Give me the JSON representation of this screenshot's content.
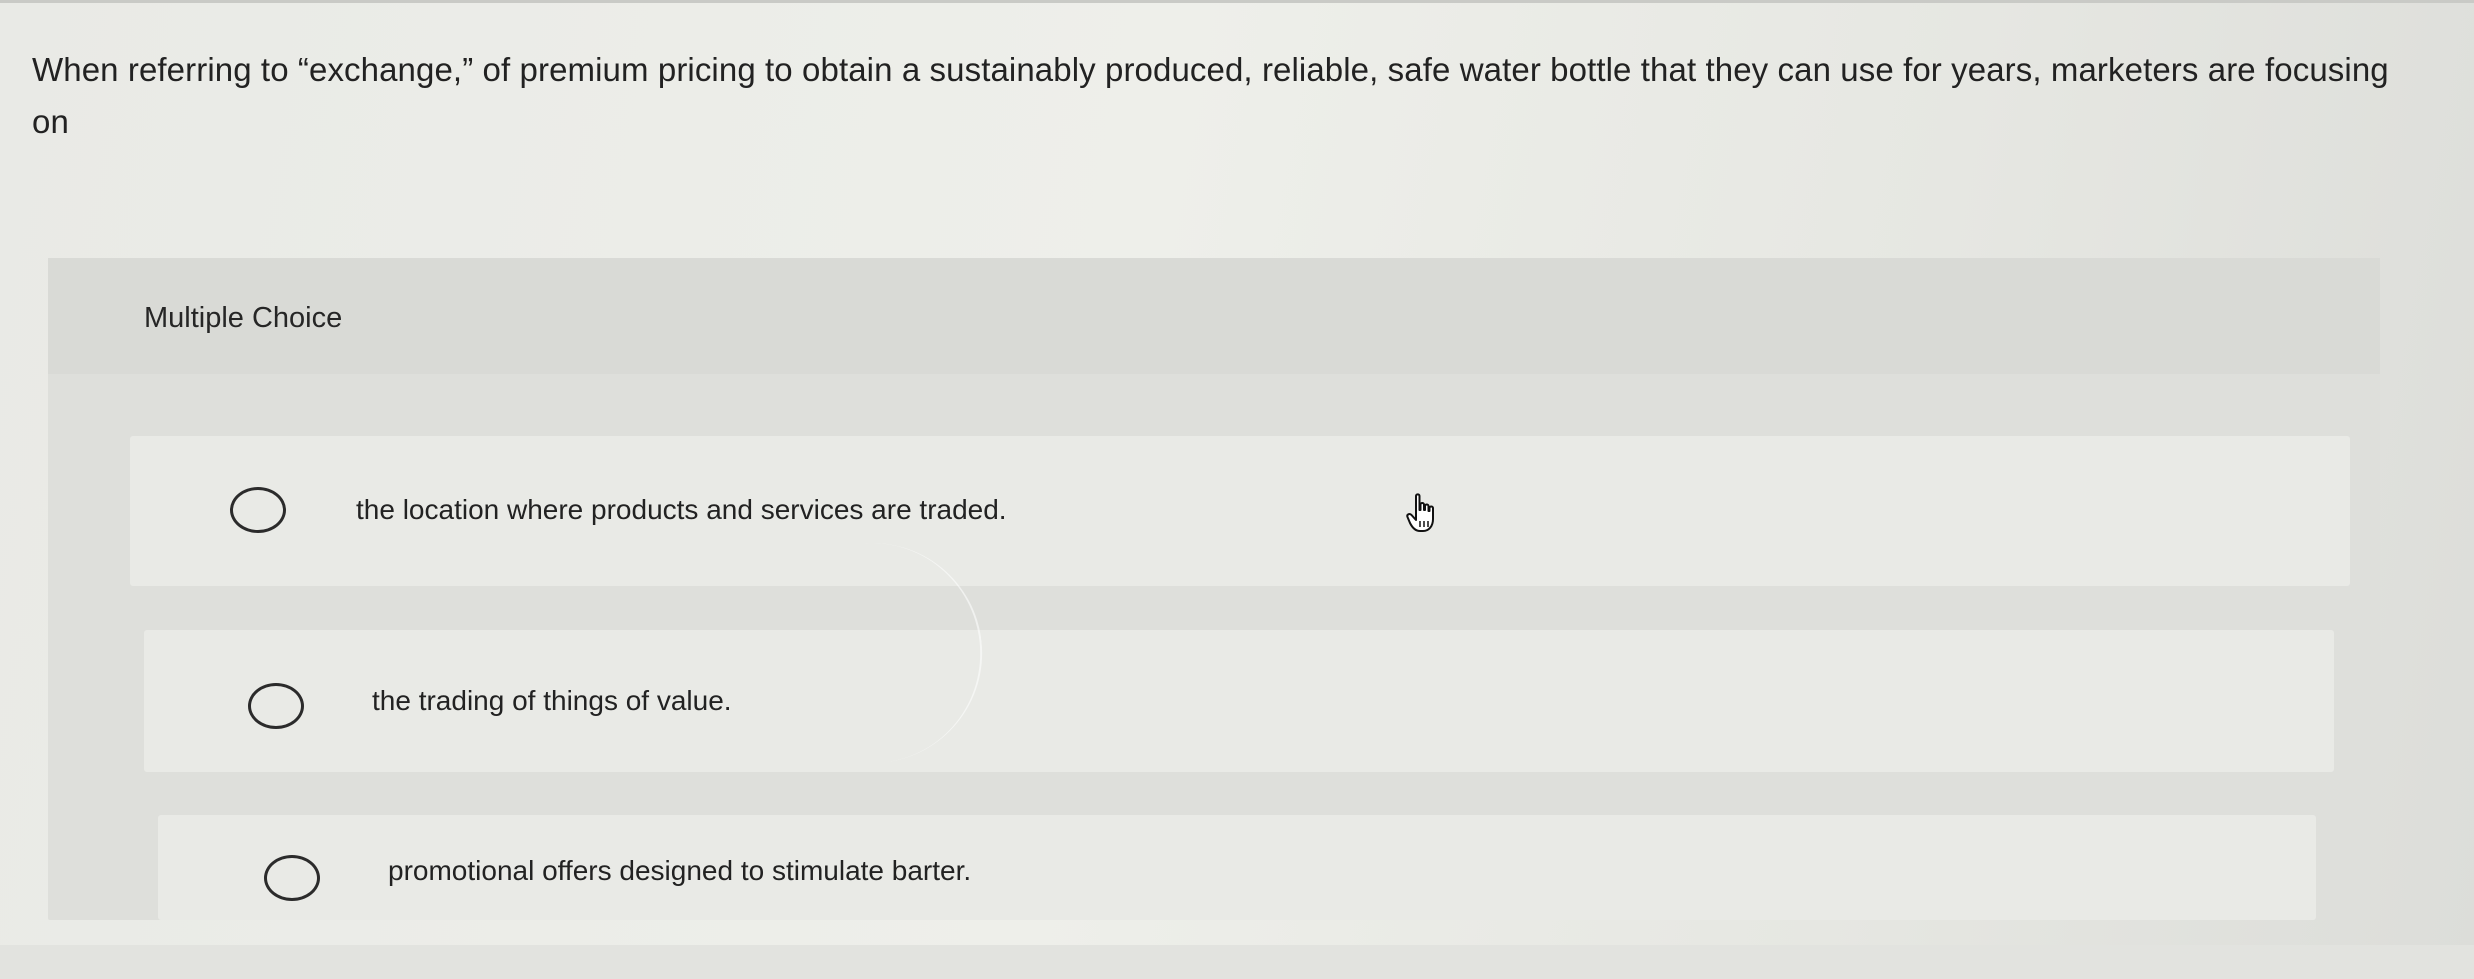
{
  "question": {
    "text": "When referring to “exchange,” of premium pricing to obtain a sustainably produced, reliable, safe water bottle that they can use for years, marketers are focusing on"
  },
  "multiple_choice": {
    "title": "Multiple Choice",
    "options": [
      {
        "label": "the location where products and services are traded.",
        "selected": false
      },
      {
        "label": "the trading of things of value.",
        "selected": false
      },
      {
        "label": "promotional offers designed to stimulate barter.",
        "selected": false
      }
    ]
  },
  "cursor": {
    "icon": "hand-pointer-icon"
  },
  "colors": {
    "text": "#222222",
    "panel": "#dedfdb",
    "option_background": "#e9eae6",
    "radio_border": "#2b2b2b"
  }
}
